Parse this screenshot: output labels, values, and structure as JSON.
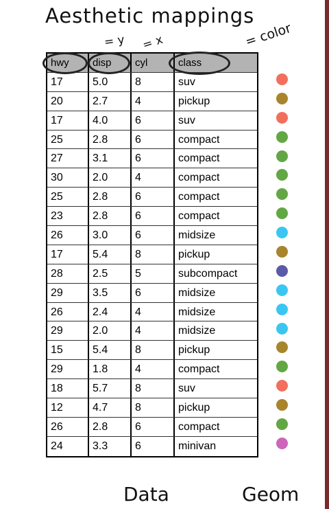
{
  "title": "Aesthetic mappings",
  "mappings": {
    "y": "= y",
    "x": "= x",
    "color": "= color"
  },
  "columns": [
    "hwy",
    "disp",
    "cyl",
    "class"
  ],
  "rows": [
    [
      "17",
      "5.0",
      "8",
      "suv"
    ],
    [
      "20",
      "2.7",
      "4",
      "pickup"
    ],
    [
      "17",
      "4.0",
      "6",
      "suv"
    ],
    [
      "25",
      "2.8",
      "6",
      "compact"
    ],
    [
      "27",
      "3.1",
      "6",
      "compact"
    ],
    [
      "30",
      "2.0",
      "4",
      "compact"
    ],
    [
      "25",
      "2.8",
      "6",
      "compact"
    ],
    [
      "23",
      "2.8",
      "6",
      "compact"
    ],
    [
      "26",
      "3.0",
      "6",
      "midsize"
    ],
    [
      "17",
      "5.4",
      "8",
      "pickup"
    ],
    [
      "28",
      "2.5",
      "5",
      "subcompact"
    ],
    [
      "29",
      "3.5",
      "6",
      "midsize"
    ],
    [
      "26",
      "2.4",
      "4",
      "midsize"
    ],
    [
      "29",
      "2.0",
      "4",
      "midsize"
    ],
    [
      "15",
      "5.4",
      "8",
      "pickup"
    ],
    [
      "29",
      "1.8",
      "4",
      "compact"
    ],
    [
      "18",
      "5.7",
      "8",
      "suv"
    ],
    [
      "12",
      "4.7",
      "8",
      "pickup"
    ],
    [
      "26",
      "2.8",
      "6",
      "compact"
    ],
    [
      "24",
      "3.3",
      "6",
      "minivan"
    ]
  ],
  "class_colors": {
    "suv": "#f26f5e",
    "pickup": "#a8852c",
    "compact": "#62a744",
    "midsize": "#3bc6f2",
    "subcompact": "#5a5ba8",
    "minivan": "#cc66bb"
  },
  "footer": {
    "left": "Data",
    "right": "Geom"
  }
}
